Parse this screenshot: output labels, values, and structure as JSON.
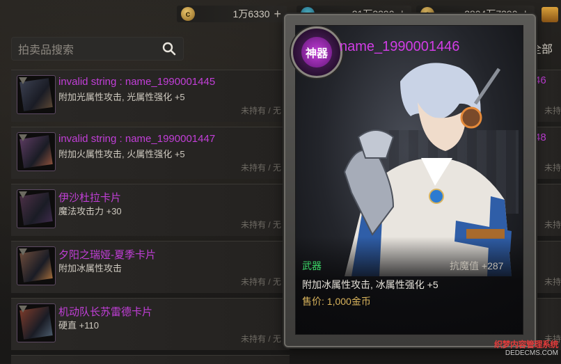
{
  "topbar": {
    "currencies": [
      {
        "icon": "gold-coin-icon",
        "value": "1万6330"
      },
      {
        "icon": "blue-gem-icon",
        "value": "21万3390"
      },
      {
        "icon": "gold-coin-icon",
        "value": "2804万7390"
      }
    ]
  },
  "search": {
    "placeholder": "拍卖品搜索"
  },
  "right_tab": {
    "label": "全部"
  },
  "auction_list": [
    {
      "title": "invalid string : name_1990001445",
      "desc": "附加光属性攻击, 光属性强化 +5",
      "ownership": "未持有 / 无"
    },
    {
      "title": "invalid string : name_1990001447",
      "desc": "附加火属性攻击, 火属性强化 +5",
      "ownership": "未持有 / 无"
    },
    {
      "title": "伊沙杜拉卡片",
      "desc": "魔法攻击力 +30",
      "ownership": "未持有 / 无"
    },
    {
      "title": "夕阳之瑞娅-夏季卡片",
      "desc": "附加冰属性攻击",
      "ownership": "未持有 / 无"
    },
    {
      "title": "机动队长苏雷德卡片",
      "desc": "硬直 +110",
      "ownership": "未持有 / 无"
    }
  ],
  "right_column": [
    {
      "num": "46",
      "ownership": "未持有"
    },
    {
      "num": "48",
      "ownership": "未持有"
    },
    {
      "num": "",
      "ownership": "未持有"
    },
    {
      "num": "",
      "ownership": "未持有"
    },
    {
      "num": "",
      "ownership": "未持有"
    }
  ],
  "card_popup": {
    "rarity_label": "神器",
    "name": "name_1990001446",
    "item_type": "武器",
    "stat": "抗魔值 +287",
    "description": "附加冰属性攻击, 冰属性强化 +5",
    "price": "售价: 1,000金币"
  },
  "watermark": {
    "main": "织梦内容管理系统",
    "sub": "DEDECMS.COM"
  },
  "colors": {
    "rarity_purple": "#c23fd8",
    "type_green": "#3bd867",
    "price_gold": "#d8b35c"
  }
}
